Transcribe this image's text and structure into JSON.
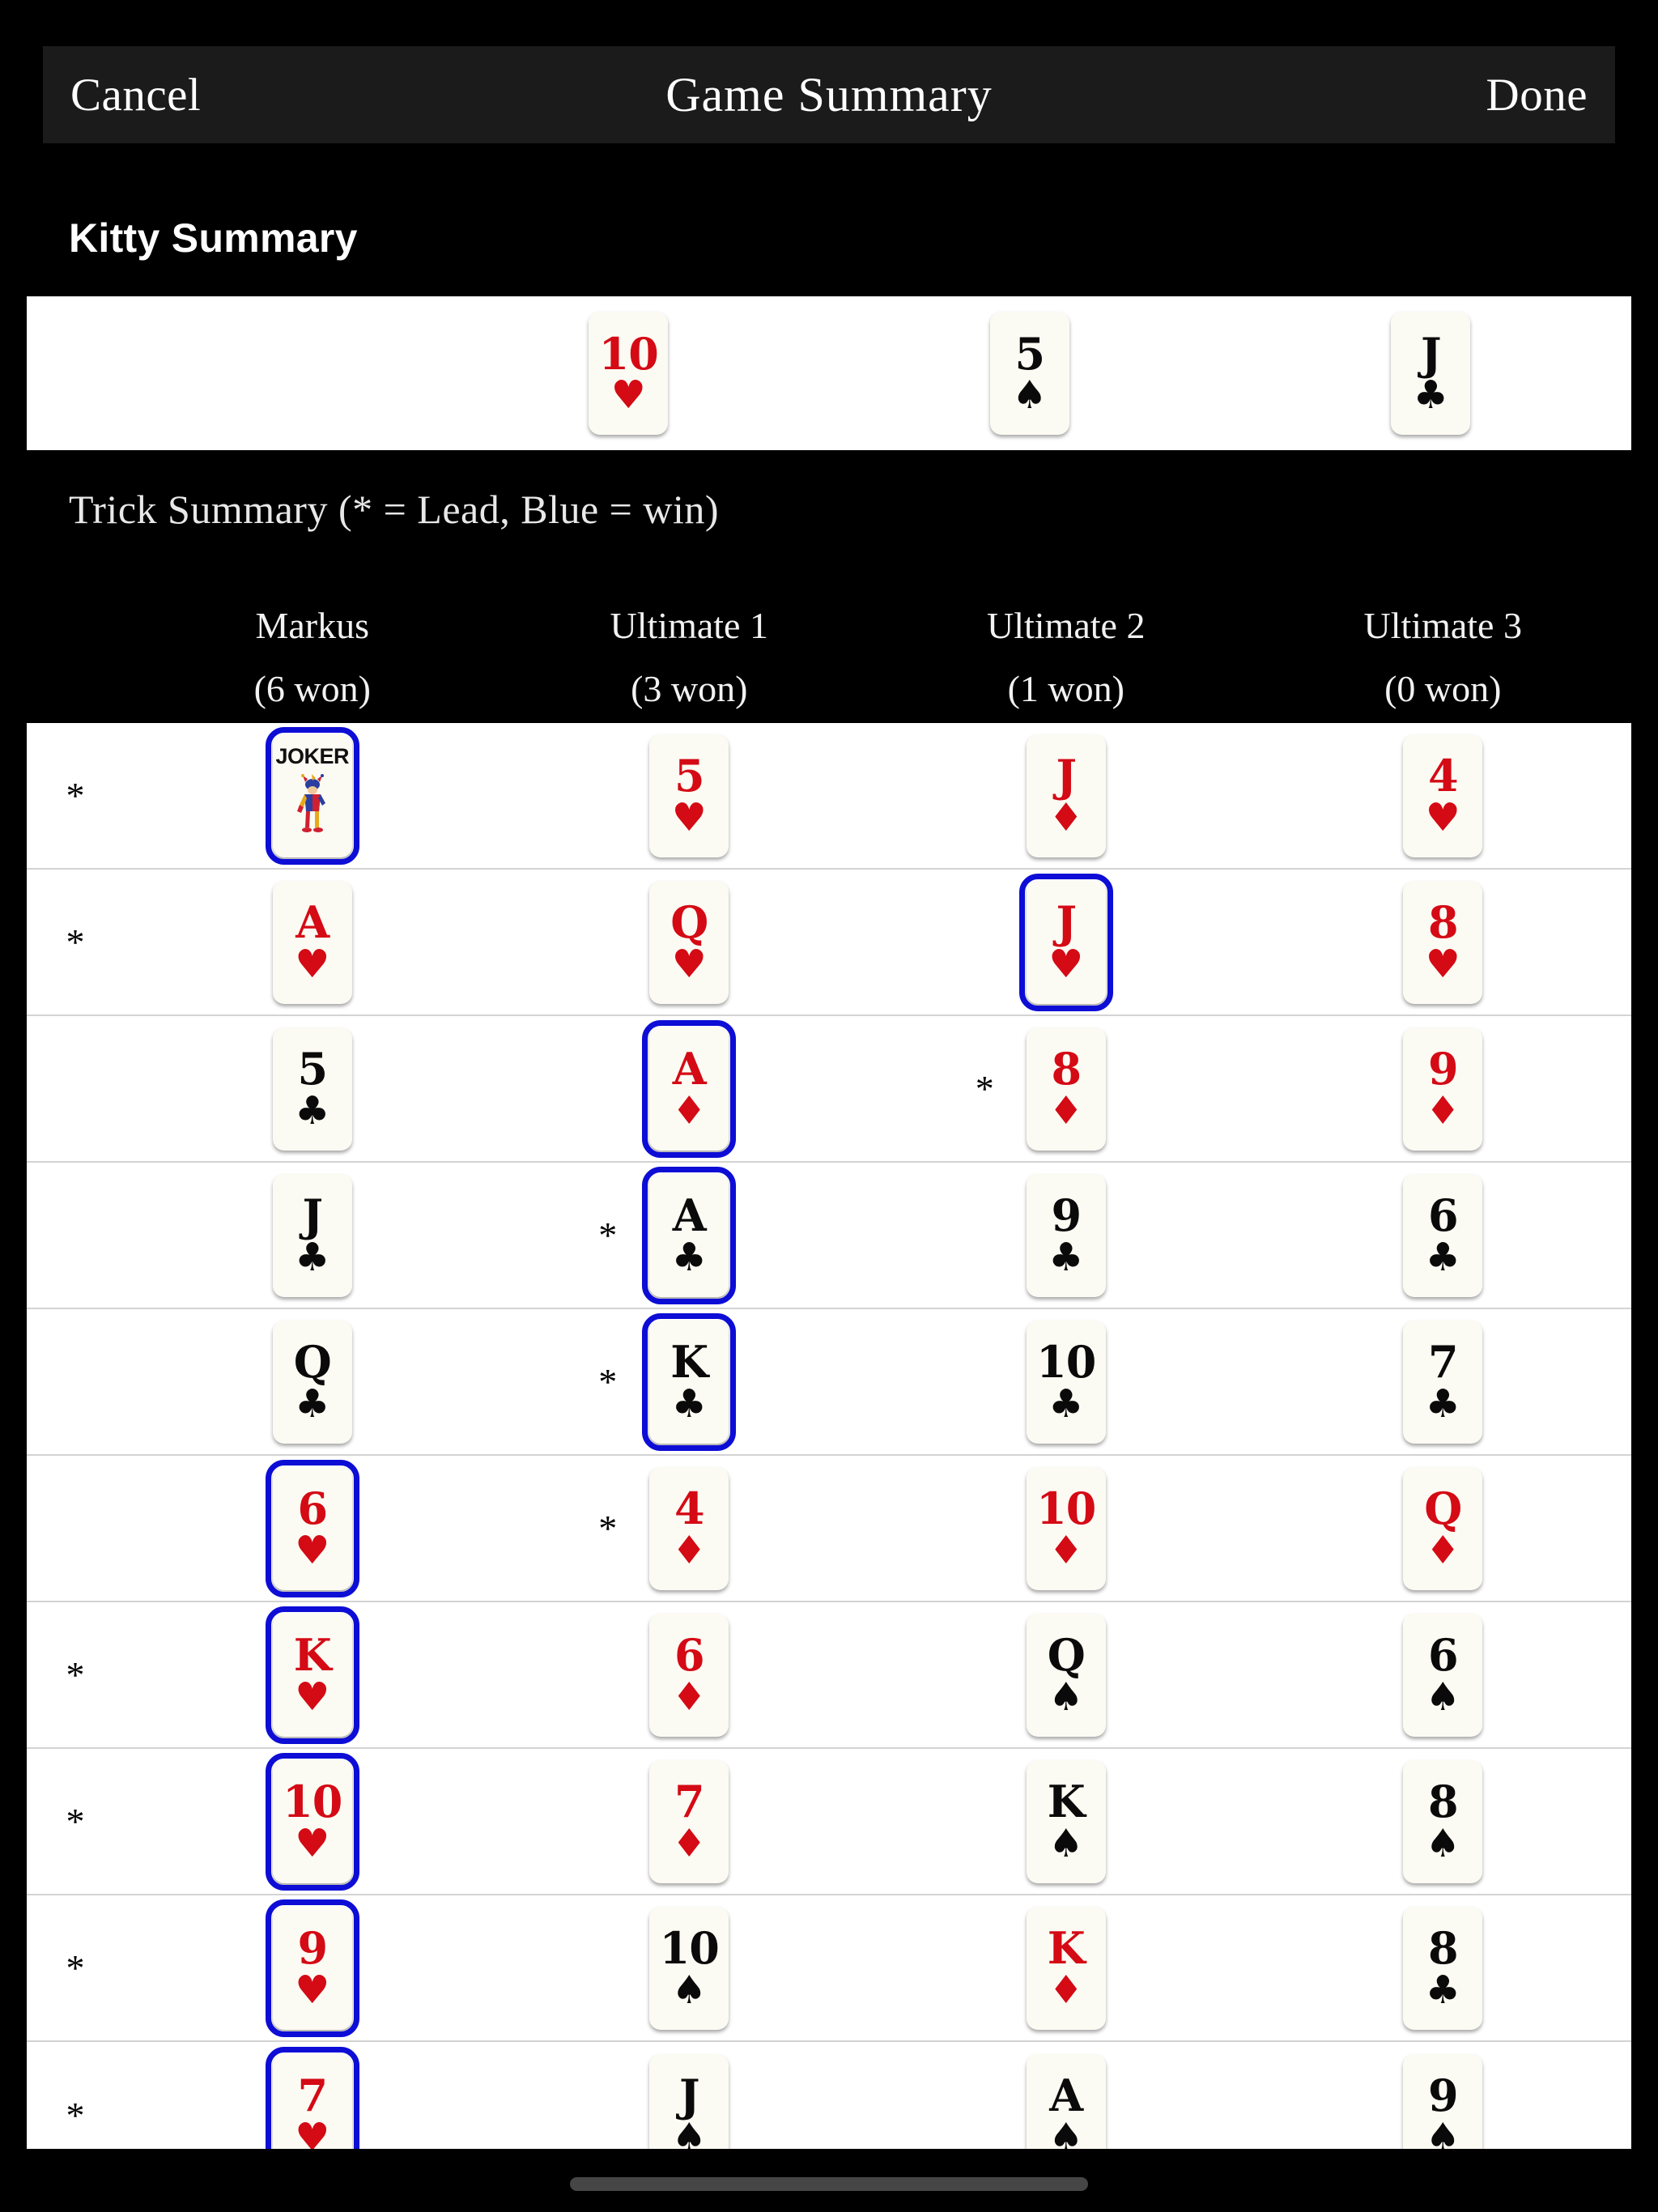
{
  "navbar": {
    "cancel_label": "Cancel",
    "title": "Game Summary",
    "done_label": "Done"
  },
  "kitty": {
    "section_title": "Kitty Summary",
    "cards": [
      {
        "rank": "10",
        "suit": "♥",
        "color": "red",
        "win": false
      },
      {
        "rank": "5",
        "suit": "♠",
        "color": "black",
        "win": false
      },
      {
        "rank": "J",
        "suit": "♣",
        "color": "black",
        "win": false
      }
    ]
  },
  "trick_summary": {
    "section_title": "Trick Summary (* = Lead, Blue = win)",
    "lead_marker": "*",
    "win_border_color": "#0d0dd6",
    "red_color": "#d40a15",
    "black_color": "#0a0a0a",
    "joker_label": "JOKER",
    "players": [
      {
        "name": "Markus",
        "won": "(6 won)"
      },
      {
        "name": "Ultimate 1",
        "won": "(3 won)"
      },
      {
        "name": "Ultimate 2",
        "won": "(1 won)"
      },
      {
        "name": "Ultimate 3",
        "won": "(0 won)"
      }
    ],
    "tricks": [
      {
        "plays": [
          {
            "rank": "JOKER",
            "suit": "",
            "color": "black",
            "joker": true,
            "lead": true,
            "win": true
          },
          {
            "rank": "5",
            "suit": "♥",
            "color": "red",
            "lead": false,
            "win": false
          },
          {
            "rank": "J",
            "suit": "♦",
            "color": "red",
            "lead": false,
            "win": false
          },
          {
            "rank": "4",
            "suit": "♥",
            "color": "red",
            "lead": false,
            "win": false
          }
        ]
      },
      {
        "plays": [
          {
            "rank": "A",
            "suit": "♥",
            "color": "red",
            "lead": true,
            "win": false
          },
          {
            "rank": "Q",
            "suit": "♥",
            "color": "red",
            "lead": false,
            "win": false
          },
          {
            "rank": "J",
            "suit": "♥",
            "color": "red",
            "lead": false,
            "win": true
          },
          {
            "rank": "8",
            "suit": "♥",
            "color": "red",
            "lead": false,
            "win": false
          }
        ]
      },
      {
        "plays": [
          {
            "rank": "5",
            "suit": "♣",
            "color": "black",
            "lead": false,
            "win": false
          },
          {
            "rank": "A",
            "suit": "♦",
            "color": "red",
            "lead": false,
            "win": true
          },
          {
            "rank": "8",
            "suit": "♦",
            "color": "red",
            "lead": true,
            "win": false
          },
          {
            "rank": "9",
            "suit": "♦",
            "color": "red",
            "lead": false,
            "win": false
          }
        ]
      },
      {
        "plays": [
          {
            "rank": "J",
            "suit": "♣",
            "color": "black",
            "lead": false,
            "win": false
          },
          {
            "rank": "A",
            "suit": "♣",
            "color": "black",
            "lead": true,
            "win": true
          },
          {
            "rank": "9",
            "suit": "♣",
            "color": "black",
            "lead": false,
            "win": false
          },
          {
            "rank": "6",
            "suit": "♣",
            "color": "black",
            "lead": false,
            "win": false
          }
        ]
      },
      {
        "plays": [
          {
            "rank": "Q",
            "suit": "♣",
            "color": "black",
            "lead": false,
            "win": false
          },
          {
            "rank": "K",
            "suit": "♣",
            "color": "black",
            "lead": true,
            "win": true
          },
          {
            "rank": "10",
            "suit": "♣",
            "color": "black",
            "lead": false,
            "win": false
          },
          {
            "rank": "7",
            "suit": "♣",
            "color": "black",
            "lead": false,
            "win": false
          }
        ]
      },
      {
        "plays": [
          {
            "rank": "6",
            "suit": "♥",
            "color": "red",
            "lead": false,
            "win": true
          },
          {
            "rank": "4",
            "suit": "♦",
            "color": "red",
            "lead": true,
            "win": false
          },
          {
            "rank": "10",
            "suit": "♦",
            "color": "red",
            "lead": false,
            "win": false
          },
          {
            "rank": "Q",
            "suit": "♦",
            "color": "red",
            "lead": false,
            "win": false
          }
        ]
      },
      {
        "plays": [
          {
            "rank": "K",
            "suit": "♥",
            "color": "red",
            "lead": true,
            "win": true
          },
          {
            "rank": "6",
            "suit": "♦",
            "color": "red",
            "lead": false,
            "win": false
          },
          {
            "rank": "Q",
            "suit": "♠",
            "color": "black",
            "lead": false,
            "win": false
          },
          {
            "rank": "6",
            "suit": "♠",
            "color": "black",
            "lead": false,
            "win": false
          }
        ]
      },
      {
        "plays": [
          {
            "rank": "10",
            "suit": "♥",
            "color": "red",
            "lead": true,
            "win": true
          },
          {
            "rank": "7",
            "suit": "♦",
            "color": "red",
            "lead": false,
            "win": false
          },
          {
            "rank": "K",
            "suit": "♠",
            "color": "black",
            "lead": false,
            "win": false
          },
          {
            "rank": "8",
            "suit": "♠",
            "color": "black",
            "lead": false,
            "win": false
          }
        ]
      },
      {
        "plays": [
          {
            "rank": "9",
            "suit": "♥",
            "color": "red",
            "lead": true,
            "win": true
          },
          {
            "rank": "10",
            "suit": "♠",
            "color": "black",
            "lead": false,
            "win": false
          },
          {
            "rank": "K",
            "suit": "♦",
            "color": "red",
            "lead": false,
            "win": false
          },
          {
            "rank": "8",
            "suit": "♣",
            "color": "black",
            "lead": false,
            "win": false
          }
        ]
      },
      {
        "plays": [
          {
            "rank": "7",
            "suit": "♥",
            "color": "red",
            "lead": true,
            "win": true
          },
          {
            "rank": "J",
            "suit": "♠",
            "color": "black",
            "lead": false,
            "win": false
          },
          {
            "rank": "A",
            "suit": "♠",
            "color": "black",
            "lead": false,
            "win": false
          },
          {
            "rank": "9",
            "suit": "♠",
            "color": "black",
            "lead": false,
            "win": false
          }
        ]
      }
    ]
  }
}
